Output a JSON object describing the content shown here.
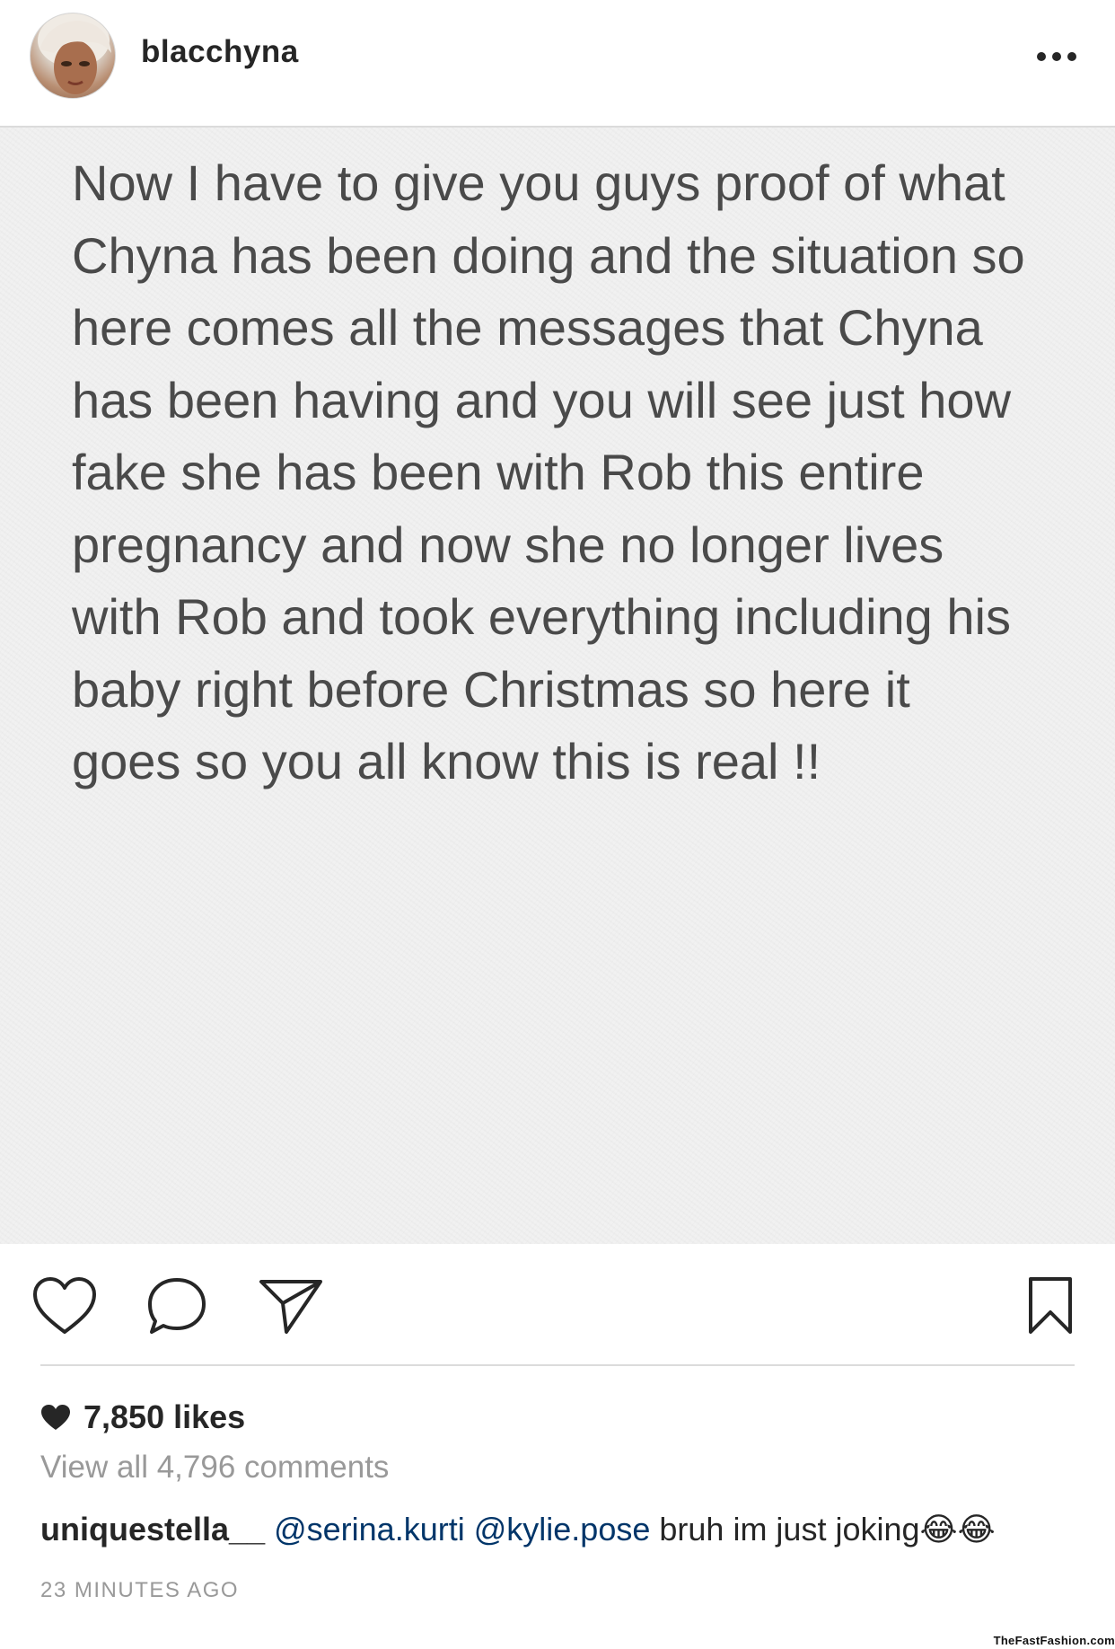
{
  "header": {
    "username": "blacchyna",
    "more_icon": "more-horizontal-icon"
  },
  "post": {
    "text": "Now I have to give you guys proof of what\nChyna has been doing and the situation so\nhere comes all the messages that Chyna\nhas been having and you will see just how\nfake she has been with Rob this entire\npregnancy and now she no longer lives\nwith Rob and took everything including his\nbaby right before Christmas so here it\ngoes so you all know this is real !!"
  },
  "actions": {
    "like_icon": "heart-outline-icon",
    "comment_icon": "comment-bubble-icon",
    "share_icon": "paper-plane-icon",
    "save_icon": "bookmark-icon"
  },
  "meta": {
    "likes": "7,850 likes",
    "view_comments": "View all 4,796 comments",
    "comment": {
      "user": "uniquestella__",
      "mention1": "@serina.kurti",
      "mention2": "@kylie.pose",
      "text": "bruh im just joking",
      "emoji": "😂😂"
    },
    "timestamp": "23 MINUTES AGO"
  },
  "watermark": "TheFastFashion.com",
  "colors": {
    "text_dark": "#262626",
    "text_muted": "#999999",
    "mention": "#003569",
    "post_text": "#4a4a4a",
    "post_bg": "#f1f1f1",
    "divider": "#dbdbdb"
  }
}
